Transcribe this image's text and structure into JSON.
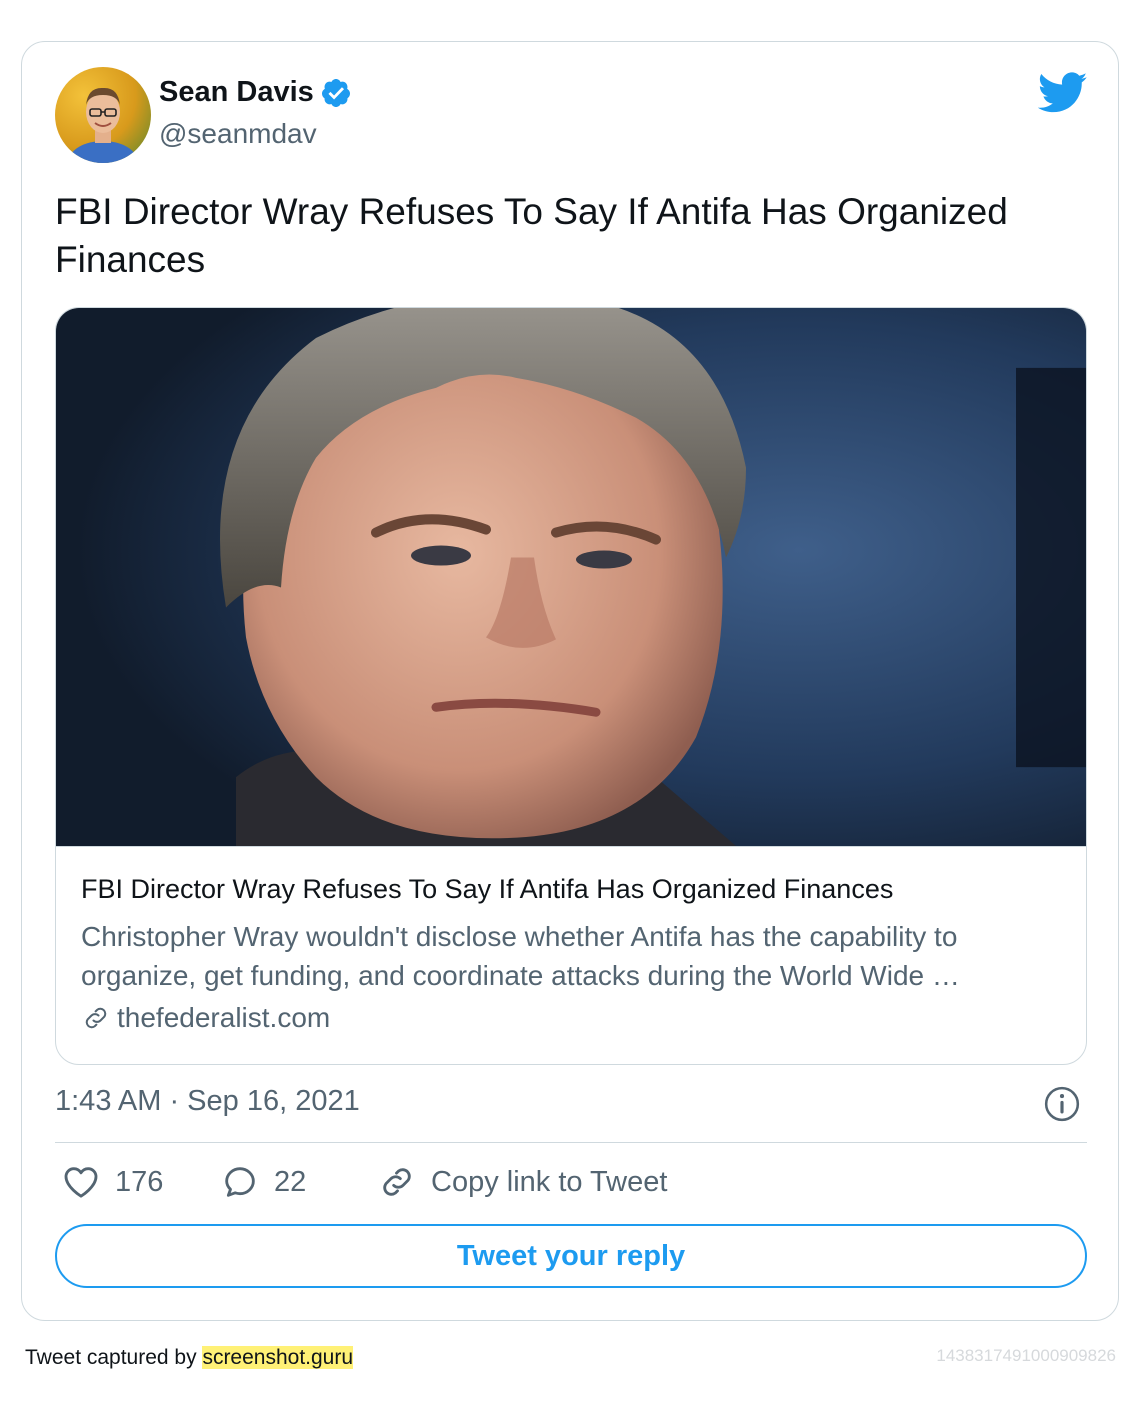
{
  "author": {
    "name": "Sean Davis",
    "handle": "@seanmdav",
    "verified": true,
    "avatar_icon": "avatar-photo"
  },
  "tweet": {
    "text": "FBI Director Wray Refuses To Say If Antifa Has Organized Finances",
    "timestamp": "1:43 AM · Sep 16, 2021"
  },
  "link_card": {
    "image_icon": "article-photo",
    "title": "FBI Director Wray Refuses To Say If Antifa Has Organized Finances",
    "description": "Christopher Wray wouldn't disclose whether Antifa has the capability to organize, get funding, and coordinate attacks during the World Wide …",
    "domain": "thefederalist.com"
  },
  "actions": {
    "likes": "176",
    "replies": "22",
    "copy_link_label": "Copy link to Tweet"
  },
  "reply_button_label": "Tweet your reply",
  "footer": {
    "prefix": "Tweet captured by ",
    "site": "screenshot.guru",
    "tweet_id": "1438317491000909826"
  },
  "colors": {
    "twitter_blue": "#1d9bf0",
    "text_primary": "#0f1419",
    "text_secondary": "#536471",
    "border": "#cfd9de",
    "highlight": "#fff176"
  }
}
